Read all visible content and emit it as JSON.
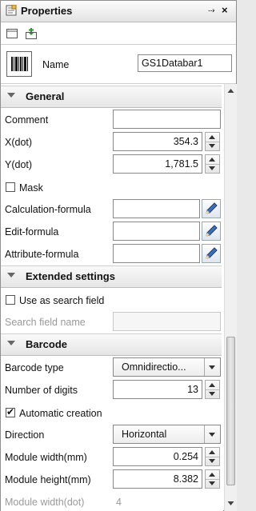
{
  "window": {
    "title": "Properties",
    "pin_glyph": "⤑",
    "close_glyph": "×"
  },
  "header": {
    "name_label": "Name",
    "name_value": "GS1Databar1"
  },
  "sections": {
    "general": "General",
    "extended": "Extended settings",
    "barcode": "Barcode"
  },
  "general": {
    "comment_label": "Comment",
    "x_label": "X(dot)",
    "x_value": "354.3",
    "y_label": "Y(dot)",
    "y_value": "1,781.5",
    "mask_label": "Mask",
    "calc_label": "Calculation-formula",
    "edit_label": "Edit-formula",
    "attr_label": "Attribute-formula"
  },
  "extended": {
    "search_label": "Use as search field",
    "search_name_label": "Search field name"
  },
  "barcode": {
    "type_label": "Barcode type",
    "type_value": "Omnidirectio...",
    "digits_label": "Number of digits",
    "digits_value": "13",
    "auto_label": "Automatic creation",
    "auto_checked": "✔",
    "direction_label": "Direction",
    "direction_value": "Horizontal",
    "mw_label": "Module width(mm)",
    "mw_value": "0.254",
    "mh_label": "Module height(mm)",
    "mh_value": "8.382",
    "mwd_label": "Module width(dot)",
    "mwd_value": "4"
  }
}
